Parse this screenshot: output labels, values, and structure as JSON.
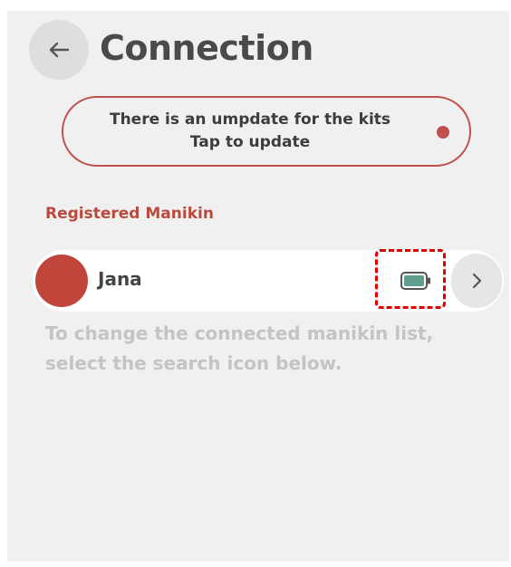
{
  "header": {
    "back_icon": "arrow-left-icon",
    "title": "Connection"
  },
  "update_banner": {
    "line1": "There is an umpdate for the kits",
    "line2": "Tap to update",
    "dot_color": "#c0504d"
  },
  "registered": {
    "section_label": "Registered Manikin",
    "manikins": [
      {
        "name": "Jana",
        "avatar_color": "#c0453a",
        "battery_icon": "battery-icon",
        "chevron_icon": "chevron-right-icon"
      }
    ]
  },
  "hint": {
    "line1": "To change the connected manikin list,",
    "line2": "select the search icon below."
  },
  "colors": {
    "accent": "#c0504d",
    "battery_fill": "#5f9e8f",
    "highlight": "#e00000"
  }
}
